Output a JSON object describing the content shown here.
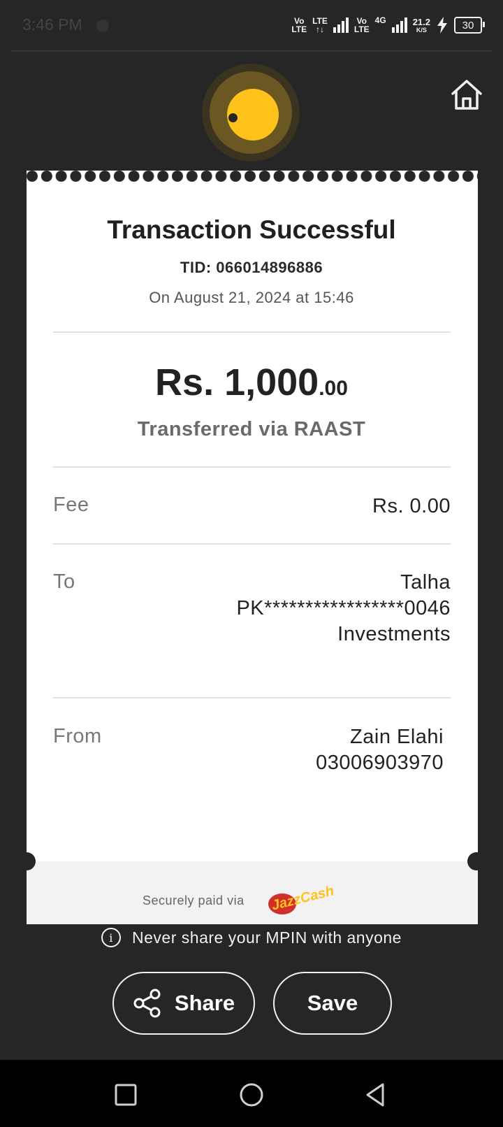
{
  "status_bar": {
    "time": "3:46 PM",
    "net1_top": "Vo",
    "net1_bottom": "LTE",
    "net2_top": "LTE",
    "net2_bottom": "↑↓",
    "net3_top": "Vo",
    "net3_bottom": "LTE",
    "net4": "4G",
    "speed_value": "21.2",
    "speed_unit": "K/S",
    "battery": "30",
    "icons": [
      "signal-icon",
      "charging-icon",
      "battery-icon"
    ]
  },
  "header": {
    "brand_icon": "jazzcash-coin-logo",
    "home_icon": "home-icon"
  },
  "receipt": {
    "title": "Transaction Successful",
    "tid": "TID: 066014896886",
    "date": "On August 21, 2024 at 15:46",
    "amount_main": "Rs. 1,000",
    "amount_decimal": ".00",
    "method": "Transferred via RAAST",
    "fee_label": "Fee",
    "fee_value": "Rs. 0.00",
    "to_label": "To",
    "to_name": "Talha",
    "to_account": "PK*****************0046",
    "to_bank": "Investments",
    "from_label": "From",
    "from_name": "Zain Elahi",
    "from_number": "03006903970",
    "secure_text": "Securely paid via",
    "secure_brand": "JazzCash"
  },
  "notice": {
    "text": "Never share your MPIN with anyone"
  },
  "actions": {
    "share_label": "Share",
    "save_label": "Save"
  },
  "colors": {
    "background": "#262626",
    "accent": "#ffc21a",
    "receipt": "#ffffff"
  }
}
